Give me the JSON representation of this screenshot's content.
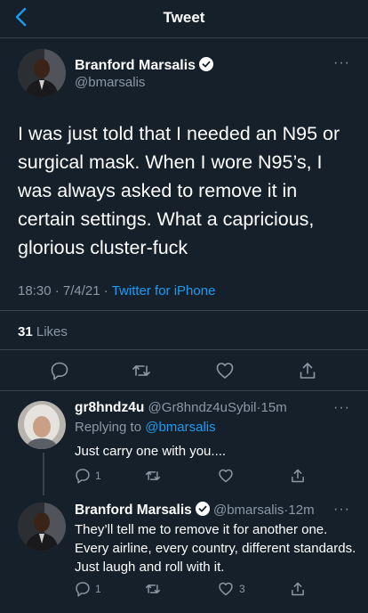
{
  "header": {
    "title": "Tweet"
  },
  "tweet": {
    "author_name": "Branford Marsalis",
    "handle": "@bmarsalis",
    "text": "I was just told that I needed an N95 or surgical mask. When I wore N95’s, I was always asked to remove it in certain settings. What a capricious, glorious cluster-fuck",
    "time": "18:30",
    "date": "7/4/21",
    "source": "Twitter for iPhone",
    "likes_count": "31",
    "likes_label": "Likes"
  },
  "reply1": {
    "author_name": "gr8hndz4u",
    "handle": "@Gr8hndz4uSybil",
    "age": "15m",
    "replying_label": "Replying to",
    "replying_handle": "@bmarsalis",
    "text": "Just carry one with you....",
    "reply_count": "1"
  },
  "reply2": {
    "author_name": "Branford Marsalis",
    "handle": "@bmarsalis",
    "age": "12m",
    "text": "They’ll tell me to remove it for another one. Every airline, every country, different standards. Just laugh and roll with it.",
    "reply_count": "1",
    "like_count": "3"
  },
  "separators": {
    "dot": "·",
    "more": "···"
  },
  "colors": {
    "background": "#15202b",
    "link": "#1d9bf0",
    "muted": "#8b98a5",
    "verified": "#ffffff"
  }
}
